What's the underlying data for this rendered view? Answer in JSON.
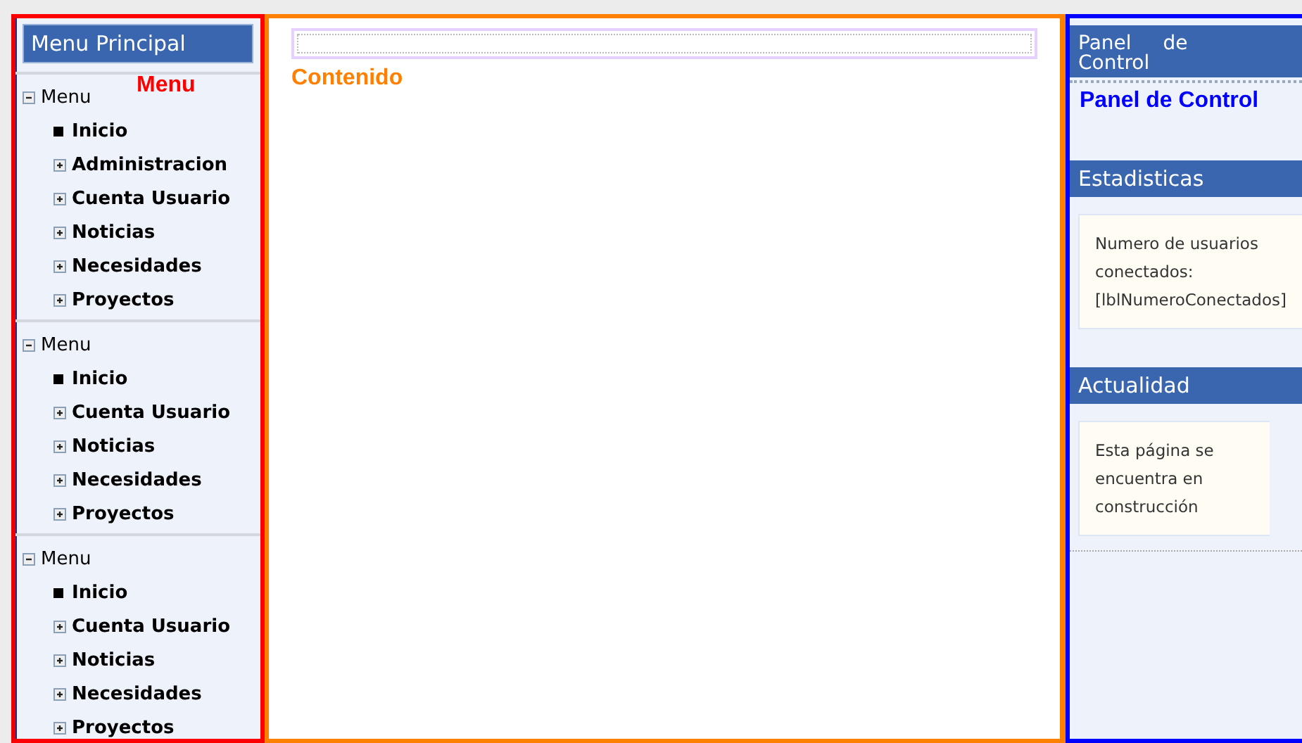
{
  "left_panel": {
    "title": "Menu Principal",
    "overlay_label": "Menu",
    "menus": [
      {
        "label": "Menu",
        "expanded": true,
        "items": [
          {
            "label": "Inicio",
            "kind": "leaf"
          },
          {
            "label": "Administracion",
            "kind": "collapsed"
          },
          {
            "label": "Cuenta Usuario",
            "kind": "collapsed"
          },
          {
            "label": "Noticias",
            "kind": "collapsed"
          },
          {
            "label": "Necesidades",
            "kind": "collapsed"
          },
          {
            "label": "Proyectos",
            "kind": "collapsed"
          }
        ]
      },
      {
        "label": "Menu",
        "expanded": true,
        "items": [
          {
            "label": "Inicio",
            "kind": "leaf"
          },
          {
            "label": "Cuenta Usuario",
            "kind": "collapsed"
          },
          {
            "label": "Noticias",
            "kind": "collapsed"
          },
          {
            "label": "Necesidades",
            "kind": "collapsed"
          },
          {
            "label": "Proyectos",
            "kind": "collapsed"
          }
        ]
      },
      {
        "label": "Menu",
        "expanded": true,
        "items": [
          {
            "label": "Inicio",
            "kind": "leaf"
          },
          {
            "label": "Cuenta Usuario",
            "kind": "collapsed"
          },
          {
            "label": "Noticias",
            "kind": "collapsed"
          },
          {
            "label": "Necesidades",
            "kind": "collapsed"
          },
          {
            "label": "Proyectos",
            "kind": "collapsed"
          }
        ]
      }
    ]
  },
  "content": {
    "label": "Contenido"
  },
  "right_panel": {
    "header": "Panel de Control",
    "title": "Panel de Control",
    "sections": [
      {
        "title": "Estadisticas",
        "text": "Numero de usuarios conectados: [lblNumeroConectados]"
      },
      {
        "title": "Actualidad",
        "text": "Esta página se encuentra en construcción"
      }
    ]
  }
}
